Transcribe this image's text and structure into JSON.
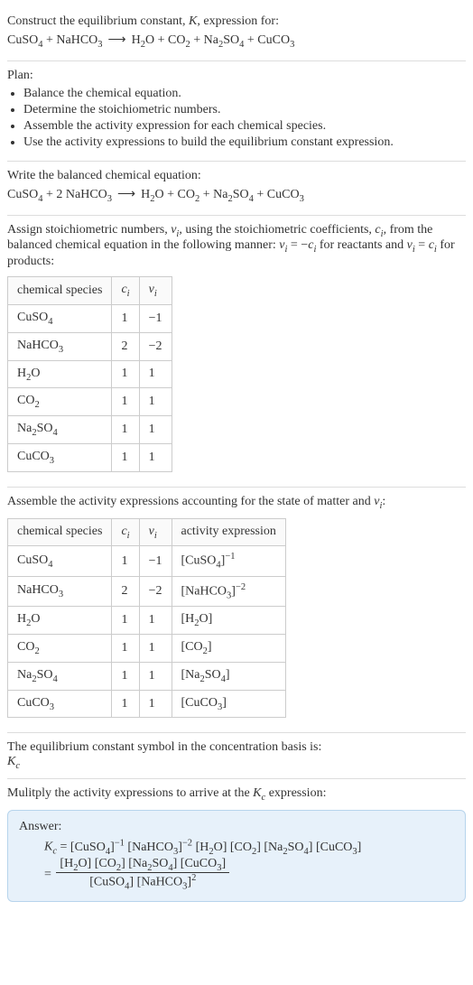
{
  "intro": {
    "line1_pre": "Construct the equilibrium constant, ",
    "line1_K": "K",
    "line1_post": ", expression for:"
  },
  "unbalanced": {
    "r1": {
      "base": "CuSO",
      "sub": "4"
    },
    "plus": " + ",
    "r2": {
      "base": "NaHCO",
      "sub": "3"
    },
    "arrow": "⟶",
    "p1": {
      "base": "H",
      "sub": "2",
      "tail": "O"
    },
    "p2": {
      "base": "CO",
      "sub": "2"
    },
    "p3": {
      "base": "Na",
      "sub": "2",
      "mid": "SO",
      "sub2": "4"
    },
    "p4": {
      "base": "CuCO",
      "sub": "3"
    }
  },
  "plan": {
    "heading": "Plan:",
    "items": [
      "Balance the chemical equation.",
      "Determine the stoichiometric numbers.",
      "Assemble the activity expression for each chemical species.",
      "Use the activity expressions to build the equilibrium constant expression."
    ]
  },
  "balanced_heading": "Write the balanced chemical equation:",
  "balanced": {
    "coef_r2": "2"
  },
  "stoich_text": {
    "p1": "Assign stoichiometric numbers, ",
    "nu": "ν",
    "i": "i",
    "p2": ", using the stoichiometric coefficients, ",
    "c": "c",
    "p3": ", from the balanced chemical equation in the following manner: ",
    "eq1_lhs": "ν",
    "eq1_eq": " = −",
    "eq1_rhs": "c",
    "p4": " for reactants and ",
    "eq2_lhs": "ν",
    "eq2_eq": " = ",
    "eq2_rhs": "c",
    "p5": " for products:"
  },
  "table1": {
    "headers": {
      "h1": "chemical species",
      "h2": "c",
      "h2sub": "i",
      "h3": "ν",
      "h3sub": "i"
    },
    "rows": [
      {
        "sp": {
          "base": "CuSO",
          "sub": "4"
        },
        "c": "1",
        "v": "−1"
      },
      {
        "sp": {
          "base": "NaHCO",
          "sub": "3"
        },
        "c": "2",
        "v": "−2"
      },
      {
        "sp": {
          "base": "H",
          "sub": "2",
          "tail": "O"
        },
        "c": "1",
        "v": "1"
      },
      {
        "sp": {
          "base": "CO",
          "sub": "2"
        },
        "c": "1",
        "v": "1"
      },
      {
        "sp": {
          "base": "Na",
          "sub": "2",
          "mid": "SO",
          "sub2": "4"
        },
        "c": "1",
        "v": "1"
      },
      {
        "sp": {
          "base": "CuCO",
          "sub": "3"
        },
        "c": "1",
        "v": "1"
      }
    ]
  },
  "assemble_text": {
    "p1": "Assemble the activity expressions accounting for the state of matter and ",
    "nu": "ν",
    "i": "i",
    "p2": ":"
  },
  "table2": {
    "headers": {
      "h1": "chemical species",
      "h2": "c",
      "h2sub": "i",
      "h3": "ν",
      "h3sub": "i",
      "h4": "activity expression"
    },
    "rows": [
      {
        "sp": {
          "base": "CuSO",
          "sub": "4"
        },
        "c": "1",
        "v": "−1",
        "act": {
          "pre": "[CuSO",
          "sub": "4",
          "post": "]",
          "exp": "−1"
        }
      },
      {
        "sp": {
          "base": "NaHCO",
          "sub": "3"
        },
        "c": "2",
        "v": "−2",
        "act": {
          "pre": "[NaHCO",
          "sub": "3",
          "post": "]",
          "exp": "−2"
        }
      },
      {
        "sp": {
          "base": "H",
          "sub": "2",
          "tail": "O"
        },
        "c": "1",
        "v": "1",
        "act": {
          "pre": "[H",
          "sub": "2",
          "tail": "O",
          "post": "]"
        }
      },
      {
        "sp": {
          "base": "CO",
          "sub": "2"
        },
        "c": "1",
        "v": "1",
        "act": {
          "pre": "[CO",
          "sub": "2",
          "post": "]"
        }
      },
      {
        "sp": {
          "base": "Na",
          "sub": "2",
          "mid": "SO",
          "sub2": "4"
        },
        "c": "1",
        "v": "1",
        "act": {
          "pre": "[Na",
          "sub": "2",
          "mid": "SO",
          "sub2": "4",
          "post": "]"
        }
      },
      {
        "sp": {
          "base": "CuCO",
          "sub": "3"
        },
        "c": "1",
        "v": "1",
        "act": {
          "pre": "[CuCO",
          "sub": "3",
          "post": "]"
        }
      }
    ]
  },
  "kc_text": {
    "line1": "The equilibrium constant symbol in the concentration basis is:",
    "K": "K",
    "c": "c"
  },
  "multiply_text": {
    "p1": "Mulitply the activity expressions to arrive at the ",
    "K": "K",
    "c": "c",
    "p2": " expression:"
  },
  "answer": {
    "label": "Answer:",
    "K": "K",
    "c": "c",
    "eq": " = ",
    "line1": {
      "t1": {
        "pre": "[CuSO",
        "sub": "4",
        "post": "]",
        "exp": "−1"
      },
      "t2": {
        "pre": "[NaHCO",
        "sub": "3",
        "post": "]",
        "exp": "−2"
      },
      "t3": {
        "pre": "[H",
        "sub": "2",
        "tail": "O",
        "post": "]"
      },
      "t4": {
        "pre": "[CO",
        "sub": "2",
        "post": "]"
      },
      "t5": {
        "pre": "[Na",
        "sub": "2",
        "mid": "SO",
        "sub2": "4",
        "post": "]"
      },
      "t6": {
        "pre": "[CuCO",
        "sub": "3",
        "post": "]"
      }
    },
    "frac": {
      "num": {
        "t1": {
          "pre": "[H",
          "sub": "2",
          "tail": "O",
          "post": "]"
        },
        "t2": {
          "pre": "[CO",
          "sub": "2",
          "post": "]"
        },
        "t3": {
          "pre": "[Na",
          "sub": "2",
          "mid": "SO",
          "sub2": "4",
          "post": "]"
        },
        "t4": {
          "pre": "[CuCO",
          "sub": "3",
          "post": "]"
        }
      },
      "den": {
        "t1": {
          "pre": "[CuSO",
          "sub": "4",
          "post": "]"
        },
        "t2": {
          "pre": "[NaHCO",
          "sub": "3",
          "post": "]",
          "exp": "2"
        }
      }
    },
    "eq2": " = "
  }
}
